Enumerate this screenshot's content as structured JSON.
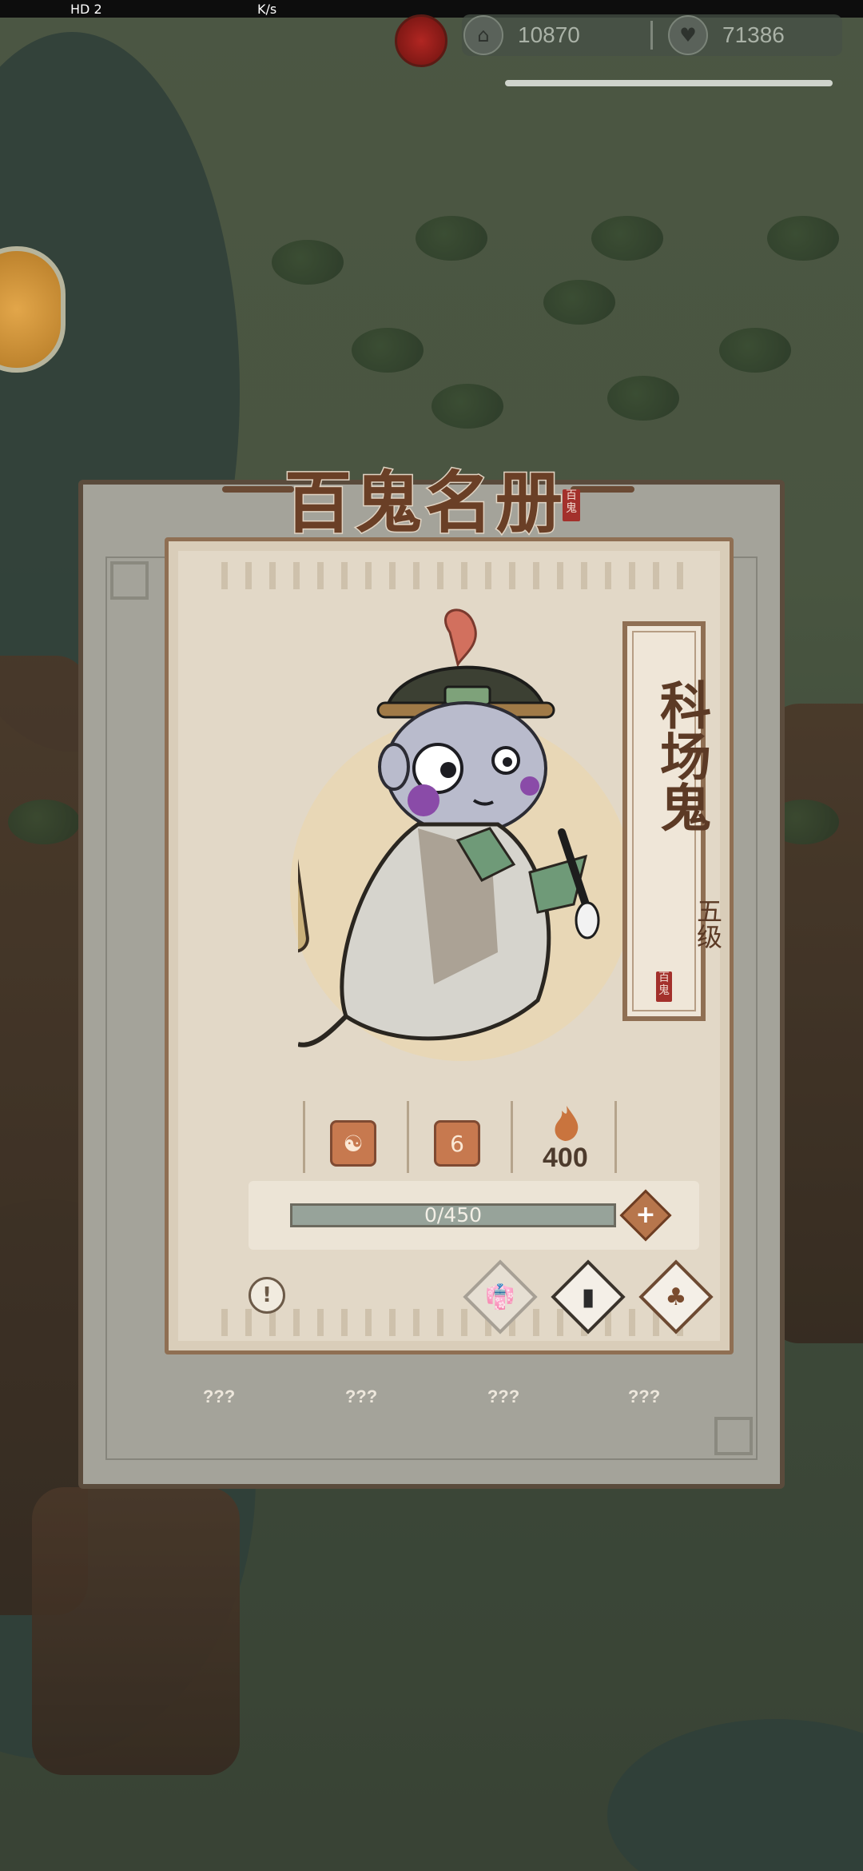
{
  "status_bar": {
    "network": "HD 2",
    "speed": "K/s"
  },
  "resources": [
    {
      "icon": "temple-icon",
      "value": "10870"
    },
    {
      "icon": "heart-icon",
      "value": "71386"
    }
  ],
  "modal": {
    "title": "百鬼名册",
    "seal": "百鬼",
    "ghost": {
      "name": "科场鬼",
      "grade": "五级",
      "seal": "百鬼",
      "stats": {
        "type_icon": "yin-yang-icon",
        "level_badge": "6",
        "fire_icon": "fire-icon",
        "fire_value": "400"
      },
      "xp_text": "0/450"
    },
    "actions": [
      "robe-icon",
      "book-icon",
      "bag-icon"
    ],
    "locked_labels": [
      "???",
      "???",
      "???",
      "???"
    ]
  },
  "colors": {
    "frame_border": "#5a4b3c",
    "card_border": "#8f6f53",
    "accent": "#b7764c"
  }
}
